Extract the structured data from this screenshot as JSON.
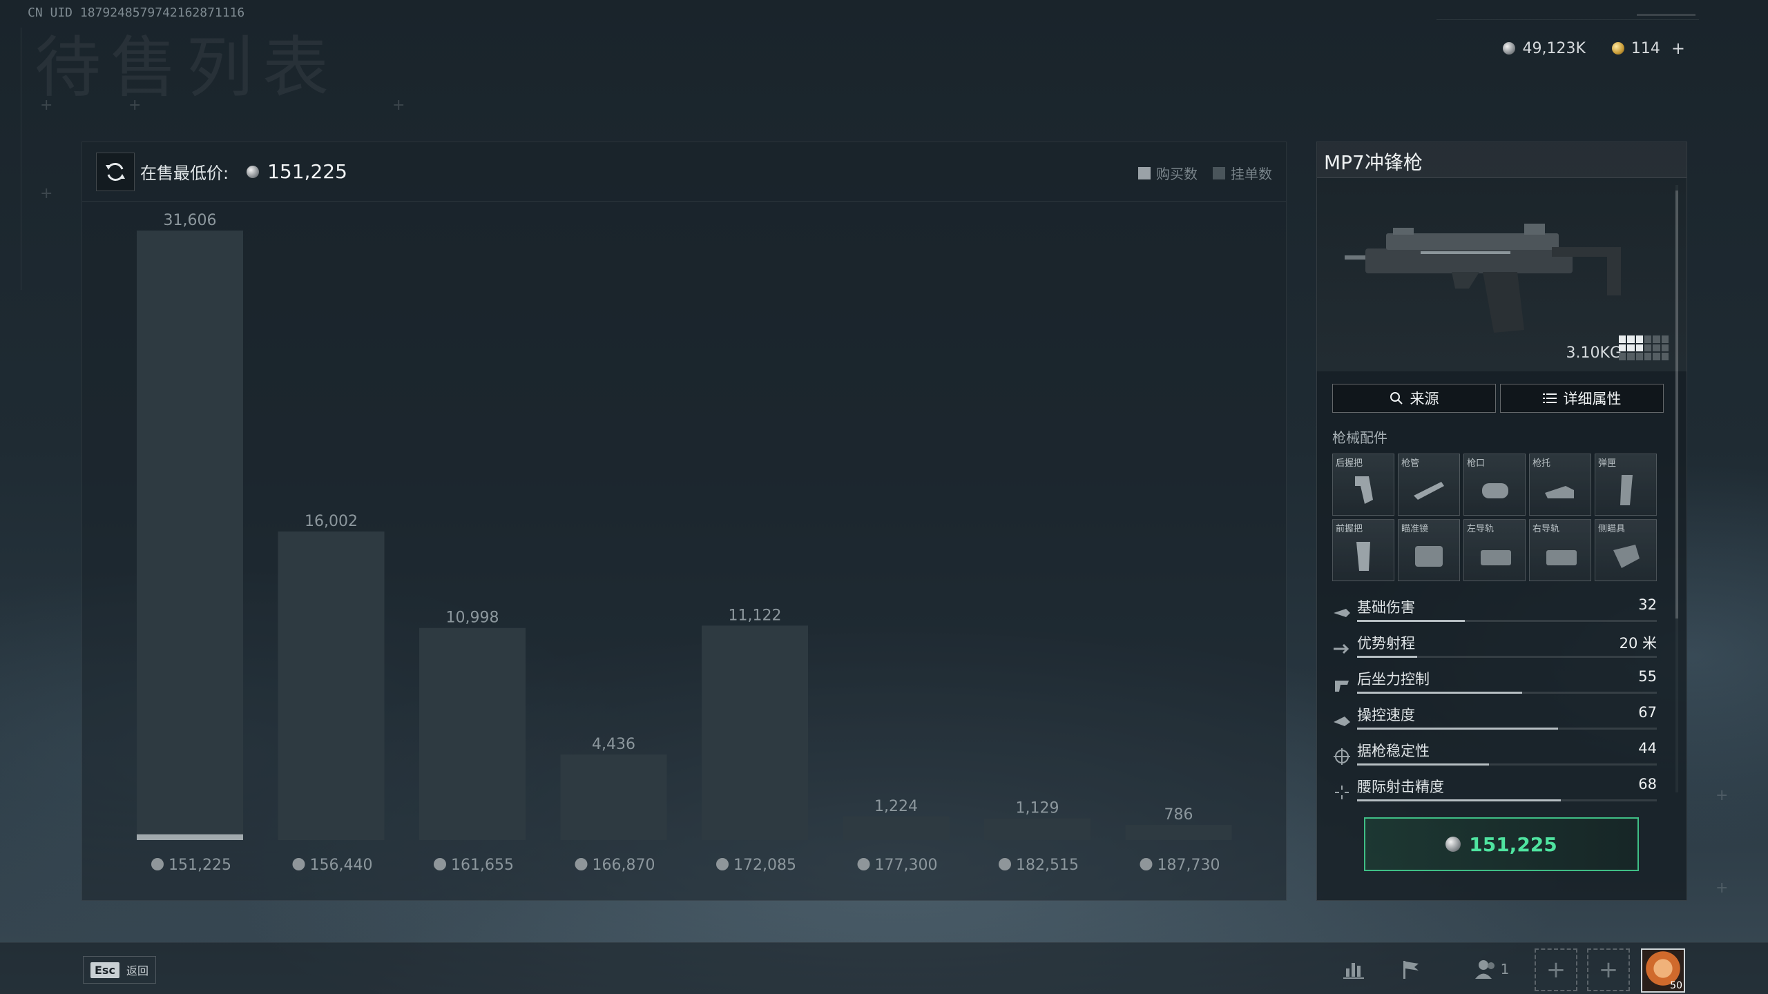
{
  "uid": "CN UID 1879248579742162871116",
  "ghost_title": "待售列表",
  "currency": {
    "silver": "49,123K",
    "gold": "114"
  },
  "chart_header": {
    "label": "在售最低价:",
    "price": "151,225",
    "legend": [
      "购买数",
      "挂单数"
    ]
  },
  "chart_data": {
    "type": "bar",
    "categories": [
      "151,225",
      "156,440",
      "161,655",
      "166,870",
      "172,085",
      "177,300",
      "182,515",
      "187,730"
    ],
    "series": [
      {
        "name": "挂单数",
        "values": [
          31606,
          16002,
          10998,
          4436,
          11122,
          1224,
          1129,
          786
        ]
      },
      {
        "name": "购买数",
        "values": [
          300,
          0,
          0,
          0,
          0,
          0,
          0,
          0
        ]
      }
    ],
    "value_labels": [
      "31,606",
      "16,002",
      "10,998",
      "4,436",
      "11,122",
      "1,224",
      "1,129",
      "786"
    ],
    "ylim": [
      0,
      31606
    ],
    "grid": false,
    "legend_position": "top-right"
  },
  "item": {
    "name": "MP7冲锋枪",
    "weight": "3.10KG",
    "size_cells_on": 6,
    "size_cells_total": 18,
    "source_btn": "来源",
    "details_btn": "详细属性",
    "attachments_label": "枪械配件",
    "attachments": [
      "后握把",
      "枪管",
      "枪口",
      "枪托",
      "弹匣",
      "前握把",
      "瞄准镜",
      "左导轨",
      "右导轨",
      "侧瞄具"
    ],
    "stats": [
      {
        "name": "基础伤害",
        "value": "32",
        "level": 0.36
      },
      {
        "name": "优势射程",
        "value": "20 米",
        "level": 0.2
      },
      {
        "name": "后坐力控制",
        "value": "55",
        "level": 0.55
      },
      {
        "name": "操控速度",
        "value": "67",
        "level": 0.67
      },
      {
        "name": "据枪稳定性",
        "value": "44",
        "level": 0.44
      },
      {
        "name": "腰际射击精度",
        "value": "68",
        "level": 0.68
      }
    ],
    "buy_price": "151,225"
  },
  "bottom": {
    "esc_key": "Esc",
    "esc_label": "返回",
    "friend_count": "1",
    "avatar_level": "50"
  }
}
